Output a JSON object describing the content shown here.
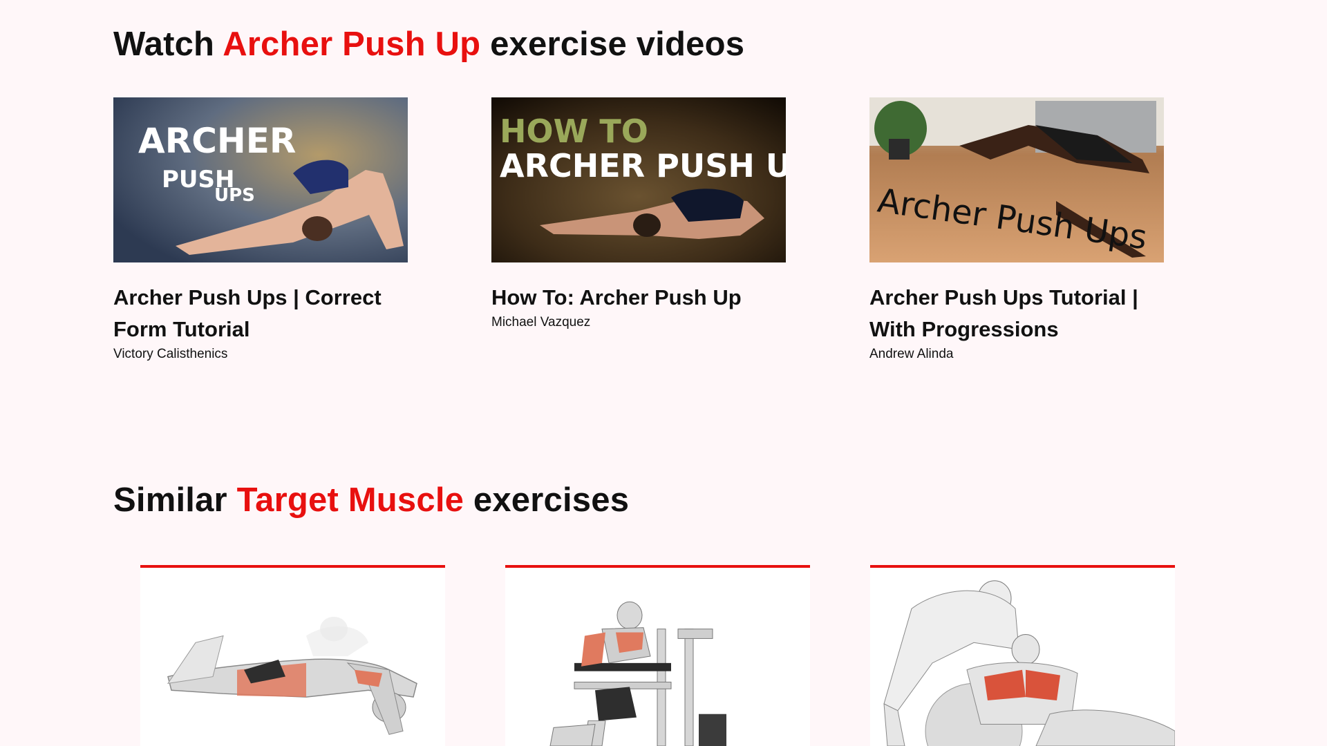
{
  "videos_section": {
    "title_prefix": "Watch ",
    "title_accent": "Archer Push Up",
    "title_suffix": " exercise videos",
    "accent_color": "#e8100f",
    "videos": [
      {
        "title": "Archer Push Ups | Correct Form Tutorial",
        "author": "Victory Calisthenics",
        "thumb_text": [
          "ARCHER",
          "PUSH",
          "UPS"
        ]
      },
      {
        "title": "How To: Archer Push Up",
        "author": "Michael Vazquez",
        "thumb_text": [
          "HOW TO",
          "ARCHER PUSH UP"
        ]
      },
      {
        "title": "Archer Push Ups Tutorial | With Progressions",
        "author": "Andrew Alinda",
        "thumb_text": [
          "Archer Push Ups"
        ]
      }
    ]
  },
  "similar_section": {
    "title_prefix": "Similar ",
    "title_accent": "Target Muscle",
    "title_suffix": " exercises"
  }
}
